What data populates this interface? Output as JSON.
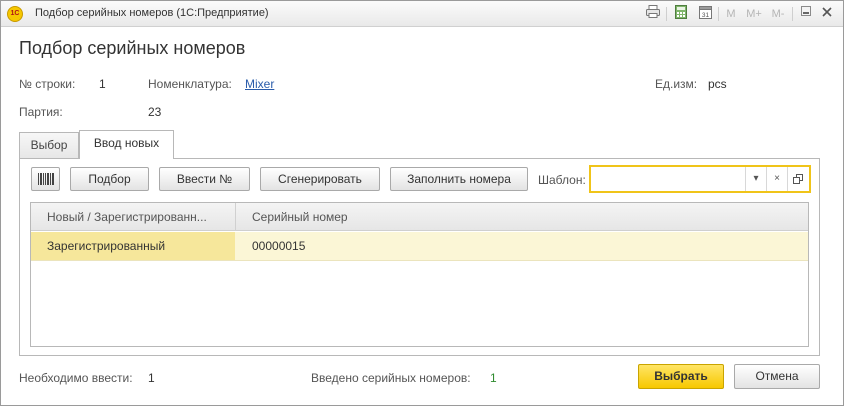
{
  "window": {
    "logo_text": "1С",
    "title": "Подбор серийных номеров  (1С:Предприятие)",
    "toolbar": {
      "memory_label": "M",
      "memory_plus_label": "M+",
      "memory_minus_label": "M-"
    }
  },
  "form": {
    "title": "Подбор серийных номеров",
    "row_label": "№ строки:",
    "row_value": "1",
    "nomenclature_label": "Номенклатура:",
    "nomenclature_value": "Mixer",
    "unit_label": "Ед.изм:",
    "unit_value": "pcs",
    "batch_label": "Партия:",
    "batch_value": "23"
  },
  "tabs": [
    {
      "label": "Выбор",
      "active": false
    },
    {
      "label": "Ввод новых",
      "active": true
    }
  ],
  "toolbar": {
    "podbor_label": "Подбор",
    "vvesti_label": "Ввести №",
    "generate_label": "Сгенерировать",
    "fill_label": "Заполнить номера",
    "template_label": "Шаблон:",
    "template_value": ""
  },
  "table": {
    "columns": [
      "Новый / Зарегистрированн...",
      "Серийный номер"
    ],
    "rows": [
      {
        "status": "Зарегистрированный",
        "serial": "00000015"
      }
    ]
  },
  "footer": {
    "need_label": "Необходимо ввести:",
    "need_value": "1",
    "entered_label": "Введено серийных номеров:",
    "entered_value": "1",
    "select_label": "Выбрать",
    "cancel_label": "Отмена"
  },
  "colors": {
    "accent_yellow": "#f7c800",
    "link_blue": "#2a5caa",
    "selected_row": "#fbf6d6",
    "count_green": "#2e8b2e"
  }
}
